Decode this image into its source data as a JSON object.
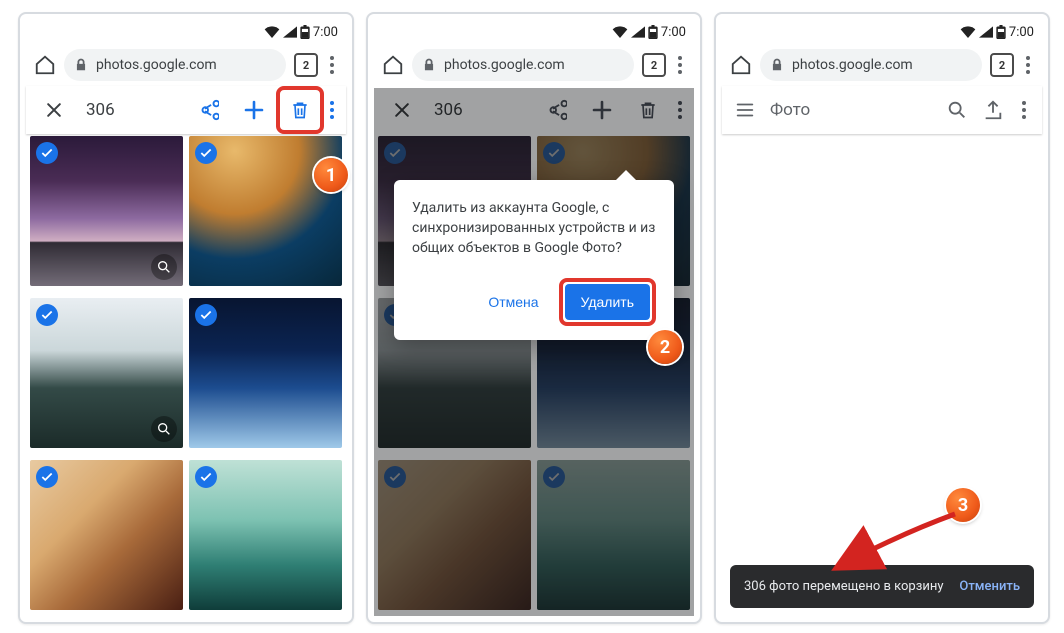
{
  "status": {
    "time": "7:00"
  },
  "browser": {
    "url": "photos.google.com",
    "tab_count": "2"
  },
  "selection": {
    "count": "306"
  },
  "dialog": {
    "message": "Удалить из аккаунта Google, с синхронизированных устройств и из общих объектов в Google Фото?",
    "cancel": "Отмена",
    "confirm": "Удалить"
  },
  "appbar": {
    "title": "Фото"
  },
  "snackbar": {
    "message": "306 фото перемещено в корзину",
    "action": "Отменить"
  },
  "badges": {
    "one": "1",
    "two": "2",
    "three": "3"
  }
}
